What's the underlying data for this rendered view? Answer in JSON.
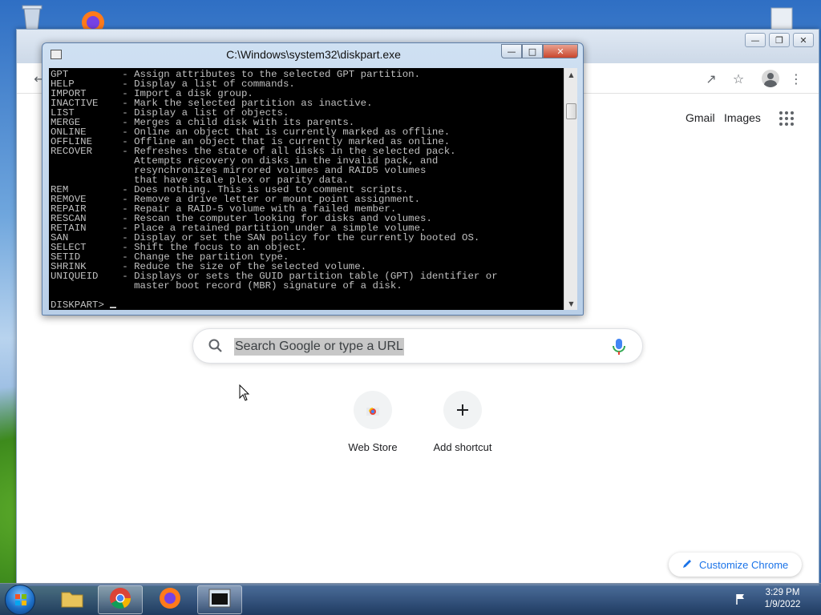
{
  "chrome": {
    "header_links": {
      "gmail": "Gmail",
      "images": "Images"
    },
    "search": {
      "placeholder": "Search Google or type a URL"
    },
    "shortcuts": [
      {
        "label": "Web Store"
      },
      {
        "label": "Add shortcut"
      }
    ],
    "customize_label": "Customize Chrome",
    "accent_color": "#1a73e8"
  },
  "cmd": {
    "title": "C:\\Windows\\system32\\diskpart.exe",
    "lines": [
      "GPT         - Assign attributes to the selected GPT partition.",
      "HELP        - Display a list of commands.",
      "IMPORT      - Import a disk group.",
      "INACTIVE    - Mark the selected partition as inactive.",
      "LIST        - Display a list of objects.",
      "MERGE       - Merges a child disk with its parents.",
      "ONLINE      - Online an object that is currently marked as offline.",
      "OFFLINE     - Offline an object that is currently marked as online.",
      "RECOVER     - Refreshes the state of all disks in the selected pack.",
      "              Attempts recovery on disks in the invalid pack, and",
      "              resynchronizes mirrored volumes and RAID5 volumes",
      "              that have stale plex or parity data.",
      "REM         - Does nothing. This is used to comment scripts.",
      "REMOVE      - Remove a drive letter or mount point assignment.",
      "REPAIR      - Repair a RAID-5 volume with a failed member.",
      "RESCAN      - Rescan the computer looking for disks and volumes.",
      "RETAIN      - Place a retained partition under a simple volume.",
      "SAN         - Display or set the SAN policy for the currently booted OS.",
      "SELECT      - Shift the focus to an object.",
      "SETID       - Change the partition type.",
      "SHRINK      - Reduce the size of the selected volume.",
      "UNIQUEID    - Displays or sets the GUID partition table (GPT) identifier or",
      "              master boot record (MBR) signature of a disk.",
      "",
      "DISKPART> "
    ]
  },
  "taskbar": {
    "items": [
      {
        "icon": "folder-icon"
      },
      {
        "icon": "chrome-icon"
      },
      {
        "icon": "firefox-icon"
      },
      {
        "icon": "cmd-window-icon"
      }
    ],
    "clock": {
      "time": "3:29 PM",
      "date": "1/9/2022"
    }
  }
}
